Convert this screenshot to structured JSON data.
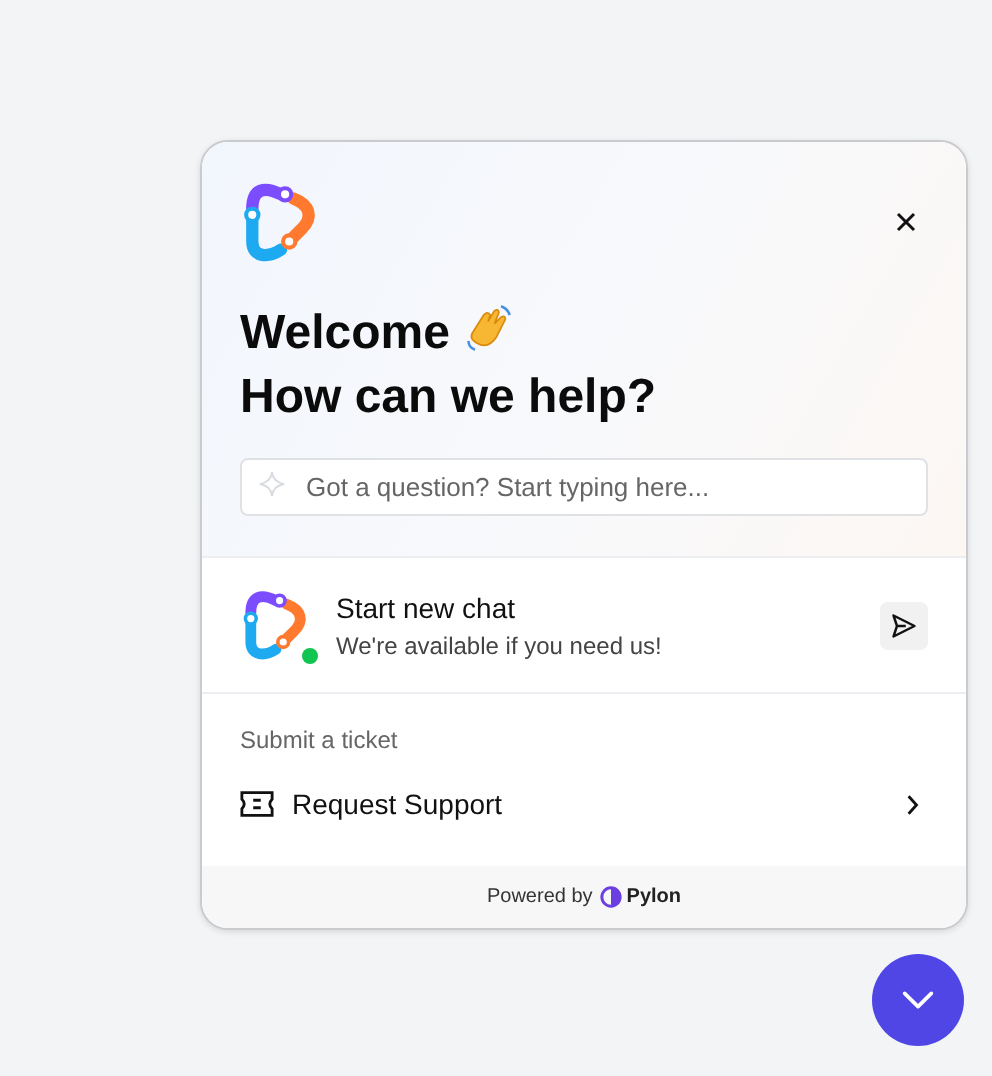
{
  "header": {
    "title_line1": "Welcome",
    "title_line2": "How can we help?"
  },
  "search": {
    "placeholder": "Got a question? Start typing here..."
  },
  "chat": {
    "title": "Start new chat",
    "subtitle": "We're available if you need us!",
    "online": true
  },
  "ticket_section": {
    "heading": "Submit a ticket",
    "items": [
      {
        "label": "Request Support"
      }
    ]
  },
  "footer": {
    "prefix": "Powered by",
    "brand": "Pylon"
  }
}
